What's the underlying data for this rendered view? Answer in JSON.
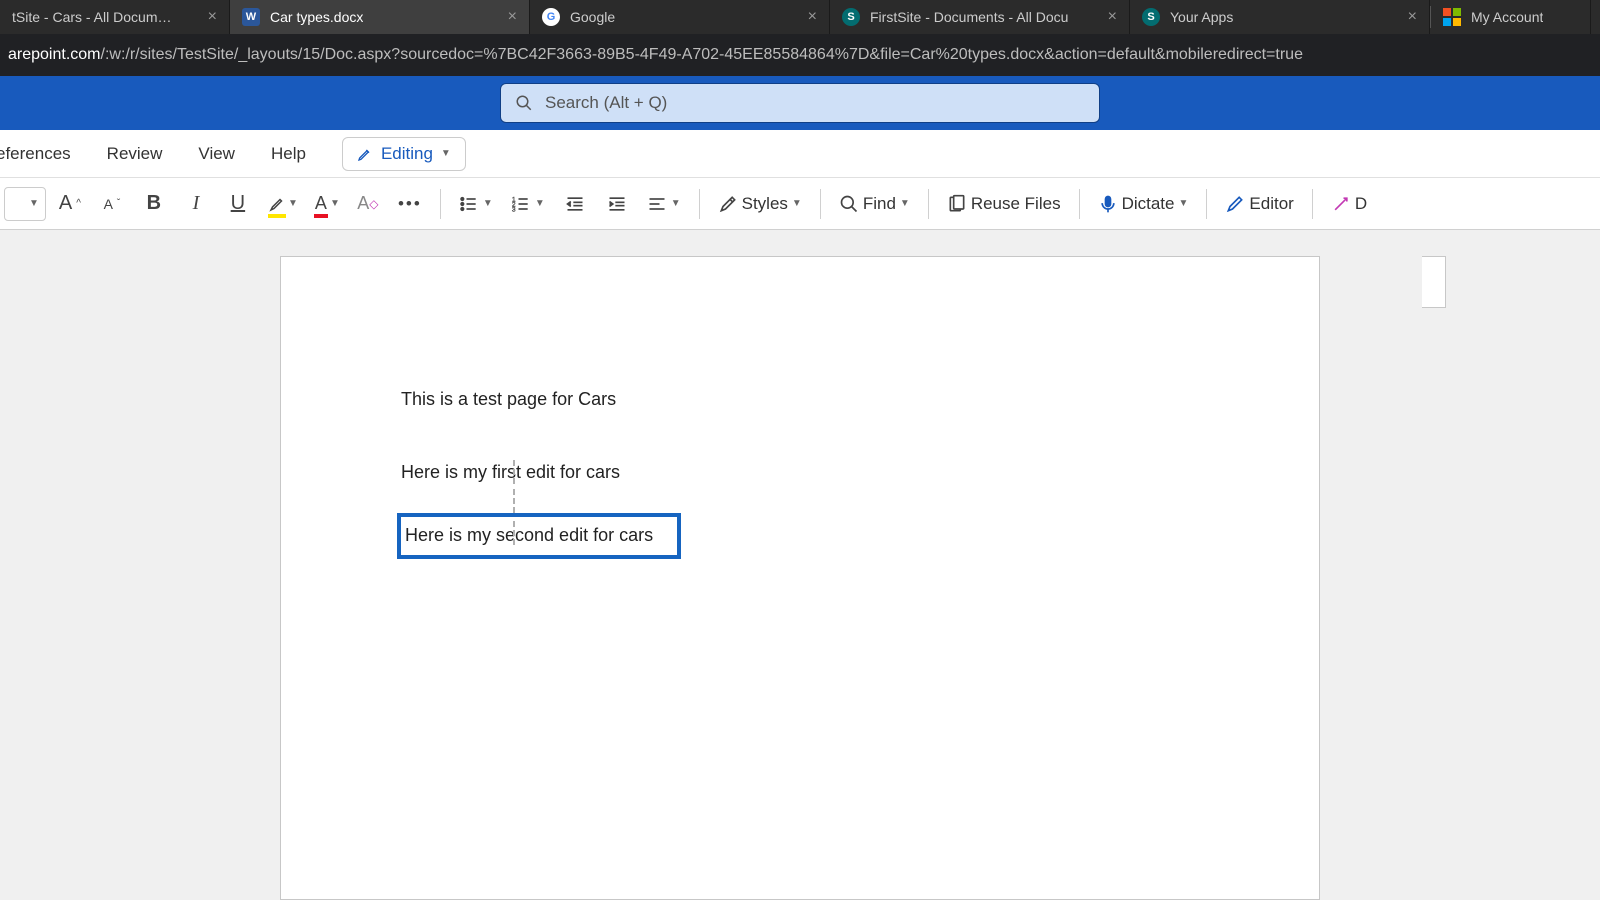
{
  "tabs": [
    {
      "icon": "sp",
      "title": "tSite - Cars - All Documents",
      "close": true,
      "active": false
    },
    {
      "icon": "w",
      "title": "Car types.docx",
      "close": true,
      "active": true
    },
    {
      "icon": "g",
      "title": "Google",
      "close": true,
      "active": false
    },
    {
      "icon": "sp",
      "title": "FirstSite - Documents - All Docu",
      "close": true,
      "active": false
    },
    {
      "icon": "sp",
      "title": "Your Apps",
      "close": true,
      "active": false
    },
    {
      "icon": "ms",
      "title": "My Account",
      "close": false,
      "active": false
    }
  ],
  "url": {
    "prefix": "arepoint.com",
    "path": "/:w:/r/sites/TestSite/_layouts/15/Doc.aspx?sourcedoc=%7BC42F3663-89B5-4F49-A702-45EE85584864%7D&file=Car%20types.docx&action=default&mobileredirect=true"
  },
  "search": {
    "placeholder": "Search (Alt + Q)"
  },
  "menu": {
    "ref": "eferences",
    "review": "Review",
    "view": "View",
    "help": "Help",
    "editing": "Editing"
  },
  "toolbar": {
    "styles": "Styles",
    "find": "Find",
    "reuse": "Reuse Files",
    "dictate": "Dictate",
    "editor": "Editor"
  },
  "doc": {
    "p1": "This is a test page for Cars",
    "p2": "Here is my first edit for cars",
    "p3": "Here is my second edit for cars"
  }
}
